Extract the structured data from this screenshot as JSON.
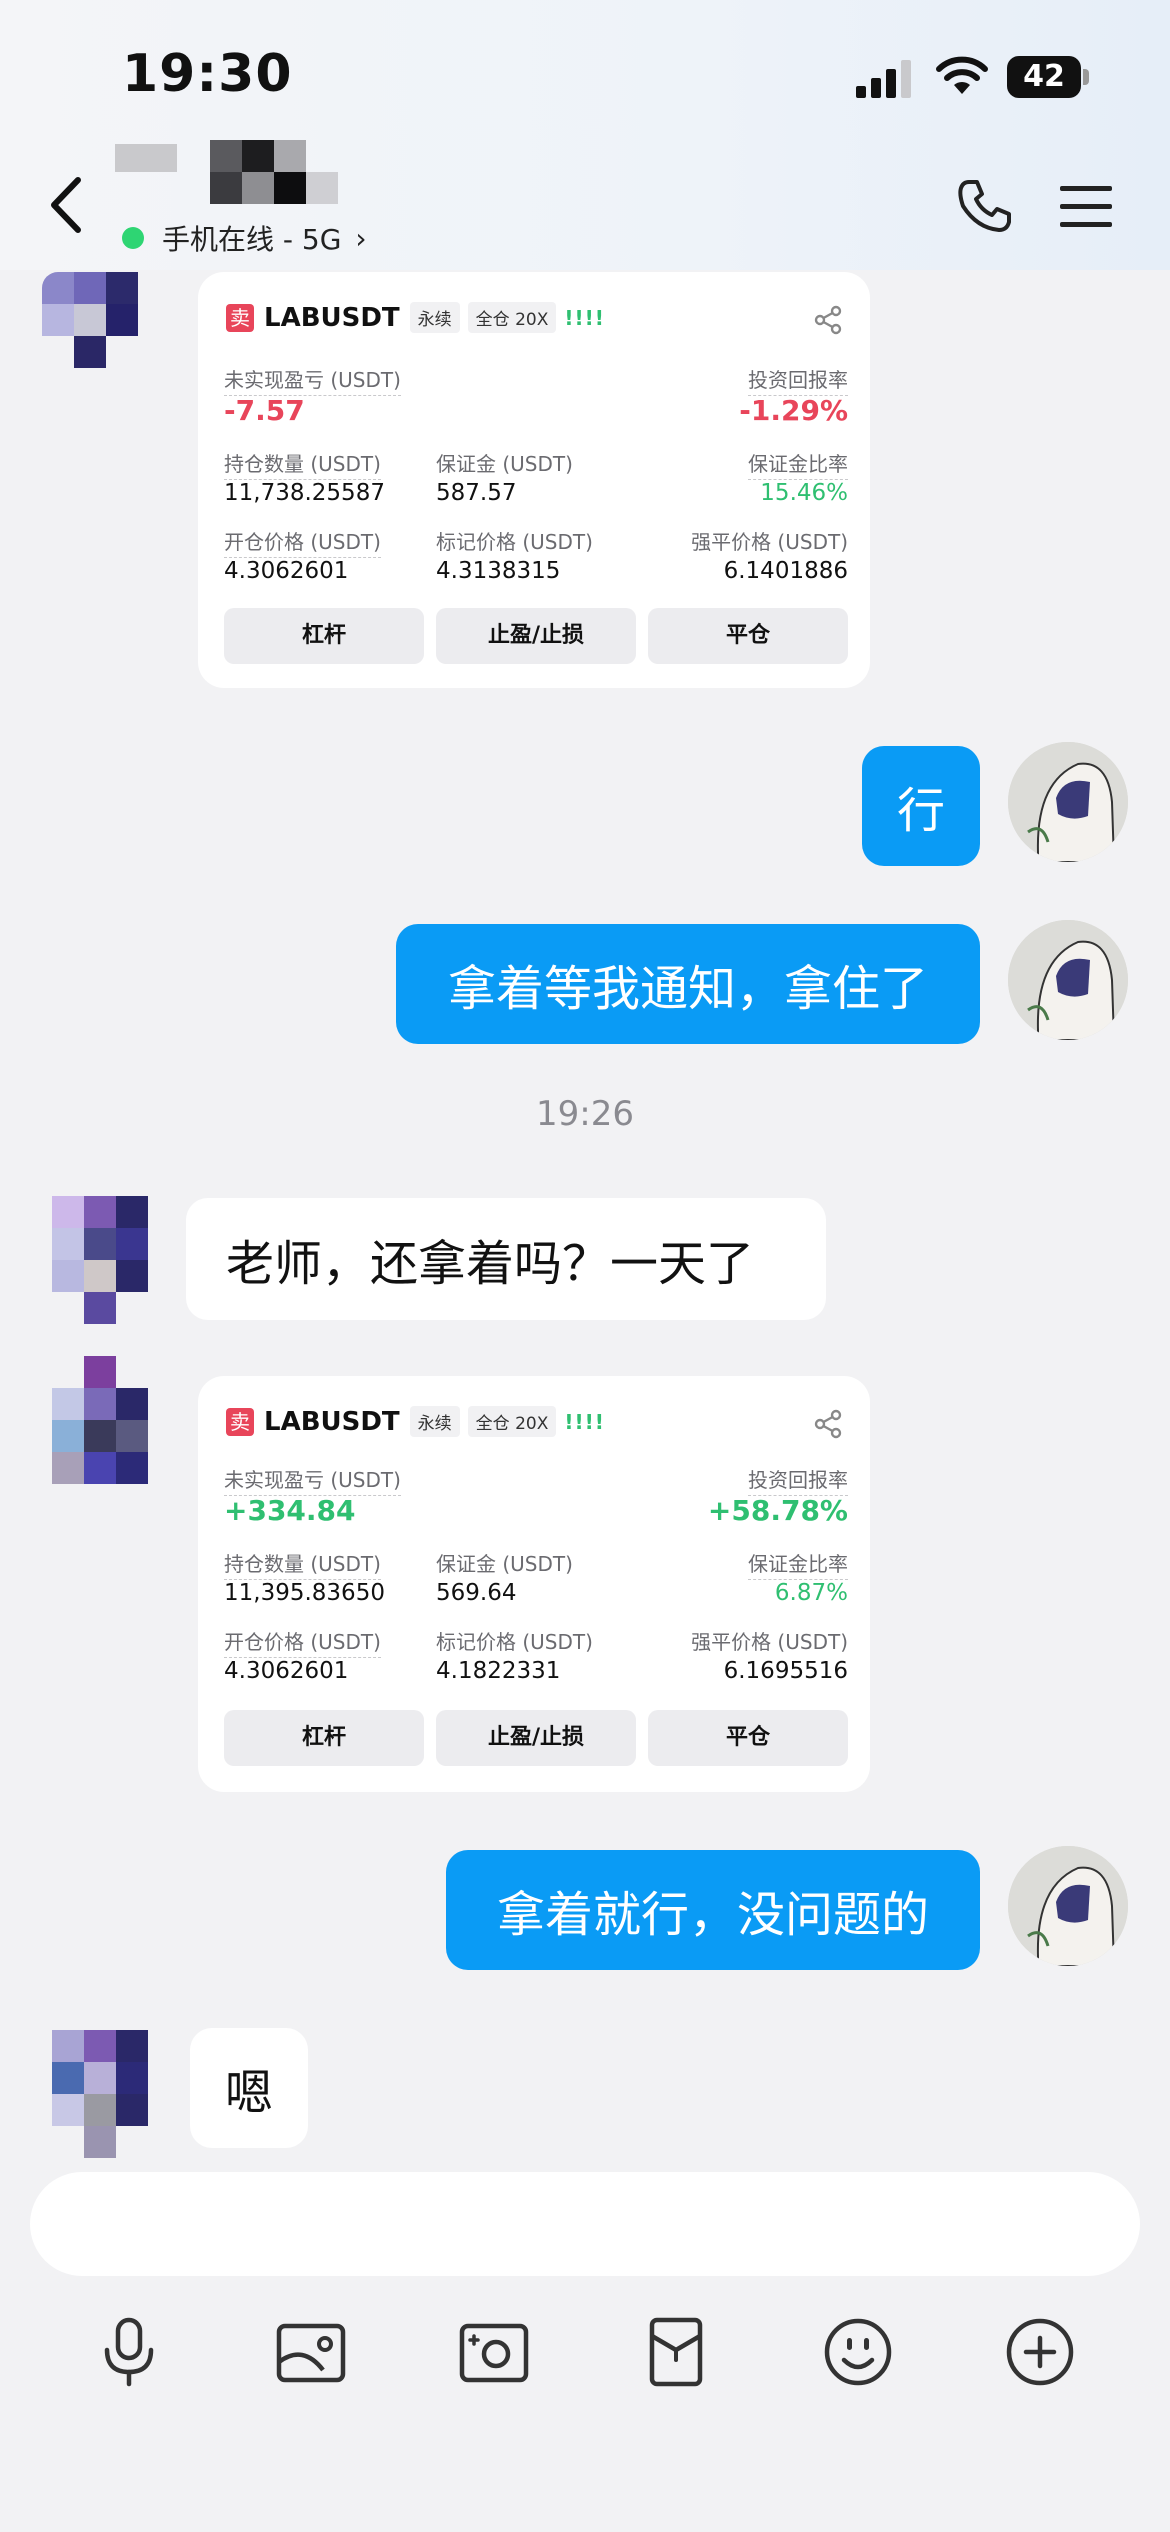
{
  "status": {
    "time": "19:30",
    "battery": "42"
  },
  "header": {
    "online": "手机在线 - 5G"
  },
  "cards": [
    {
      "side_tag": "卖",
      "symbol": "LABUSDT",
      "chip1": "永续",
      "chip2": "全仓 20X",
      "bars": "!!!!",
      "pnl_label": "未实现盈亏 (USDT)",
      "pnl_value": "-7.57",
      "roi_label": "投资回报率",
      "roi_value": "-1.29%",
      "qty_label": "持仓数量 (USDT)",
      "qty_value": "11,738.25587",
      "margin_label": "保证金 (USDT)",
      "margin_value": "587.57",
      "ratio_label": "保证金比率",
      "ratio_value": "15.46%",
      "open_label": "开仓价格 (USDT)",
      "open_value": "4.3062601",
      "mark_label": "标记价格 (USDT)",
      "mark_value": "4.3138315",
      "liq_label": "强平价格 (USDT)",
      "liq_value": "6.1401886",
      "btn1": "杠杆",
      "btn2": "止盈/止损",
      "btn3": "平仓"
    },
    {
      "side_tag": "卖",
      "symbol": "LABUSDT",
      "chip1": "永续",
      "chip2": "全仓 20X",
      "bars": "!!!!",
      "pnl_label": "未实现盈亏 (USDT)",
      "pnl_value": "+334.84",
      "roi_label": "投资回报率",
      "roi_value": "+58.78%",
      "qty_label": "持仓数量 (USDT)",
      "qty_value": "11,395.83650",
      "margin_label": "保证金 (USDT)",
      "margin_value": "569.64",
      "ratio_label": "保证金比率",
      "ratio_value": "6.87%",
      "open_label": "开仓价格 (USDT)",
      "open_value": "4.3062601",
      "mark_label": "标记价格 (USDT)",
      "mark_value": "4.1822331",
      "liq_label": "强平价格 (USDT)",
      "liq_value": "6.1695516",
      "btn1": "杠杆",
      "btn2": "止盈/止损",
      "btn3": "平仓"
    }
  ],
  "messages": {
    "me1": "行",
    "me2": "拿着等我通知，拿住了",
    "timestamp": "19:26",
    "other1": "老师，还拿着吗？一天了",
    "me3": "拿着就行，没问题的",
    "other2": "嗯"
  },
  "colors": {
    "accent_blue": "#0a9bf5",
    "loss_red": "#e8455a",
    "gain_green": "#2fbf71",
    "online_green": "#2ed573"
  },
  "icons": {
    "toolbar": [
      "microphone-icon",
      "image-icon",
      "camera-icon",
      "red-packet-icon",
      "emoji-icon",
      "plus-icon"
    ]
  }
}
